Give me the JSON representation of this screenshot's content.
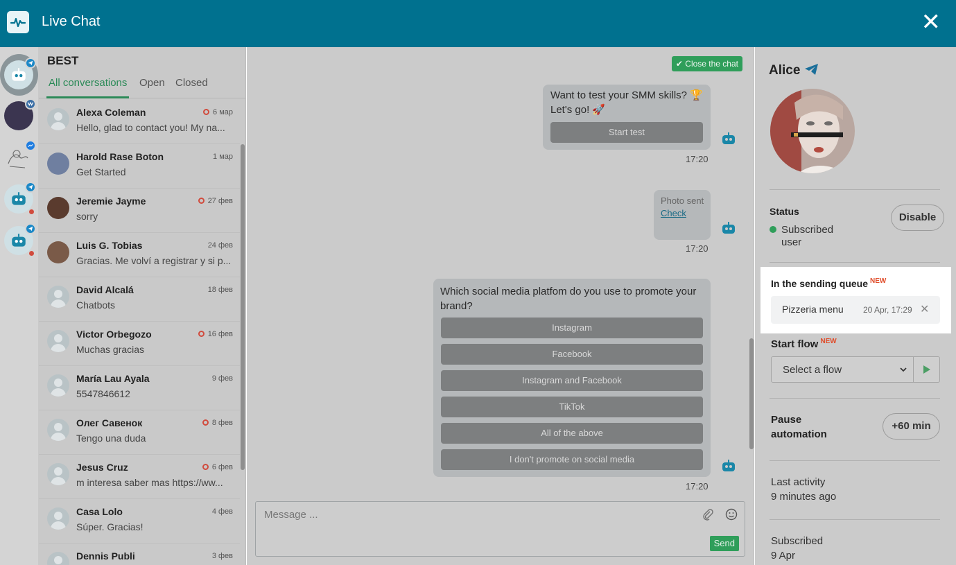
{
  "header": {
    "title": "Live Chat",
    "close_symbol": "✕",
    "bg_color": "#00718f"
  },
  "conversation_list": {
    "project_name": "BEST",
    "tabs": [
      "All conversations",
      "Open",
      "Closed"
    ],
    "active_tab": "All conversations",
    "items": [
      {
        "name": "Alexa Coleman",
        "date": "6 мар",
        "unread": true,
        "message": "Hello, glad to contact you! My na..."
      },
      {
        "name": "Harold Rase Boton",
        "date": "1 мар",
        "unread": false,
        "message": "Get Started"
      },
      {
        "name": "Jeremie Jayme",
        "date": "27 фев",
        "unread": true,
        "message": "sorry"
      },
      {
        "name": "Luis G. Tobias",
        "date": "24 фев",
        "unread": false,
        "message": "Gracias. Me volví a registrar y si p..."
      },
      {
        "name": "David Alcalá",
        "date": "18 фев",
        "unread": false,
        "message": "Chatbots"
      },
      {
        "name": "Victor Orbegozo",
        "date": "16 фев",
        "unread": true,
        "message": "Muchas gracias"
      },
      {
        "name": "María Lau Ayala",
        "date": "9 фев",
        "unread": false,
        "message": "5547846612"
      },
      {
        "name": "Олег Савенок",
        "date": "8 фев",
        "unread": true,
        "message": "Tengo una duda"
      },
      {
        "name": "Jesus Cruz",
        "date": "6 фев",
        "unread": true,
        "message": "m interesa saber mas https://ww..."
      },
      {
        "name": "Casa Lolo",
        "date": "4 фев",
        "unread": false,
        "message": "Súper. Gracias!"
      },
      {
        "name": "Dennis Publi",
        "date": "3 фев",
        "unread": false,
        "message": ""
      }
    ]
  },
  "chat": {
    "close_button": "Close the chat",
    "messages": [
      {
        "text_line1": "Want to test your SMM skills? 🏆",
        "text_line2": "Let's go! 🚀",
        "button": "Start test",
        "time": "17:20"
      },
      {
        "photo_label": "Photo sent",
        "photo_link": "Check",
        "time": "17:20"
      },
      {
        "text_line1": "Which social media platfom do you use to promote your",
        "text_line2": "brand?",
        "buttons": [
          "Instagram",
          "Facebook",
          "Instagram and Facebook",
          "TikTok",
          "All of the above",
          "I don't promote on social media"
        ],
        "time": "17:20"
      }
    ],
    "composer_placeholder": "Message ...",
    "send_label": "Send"
  },
  "profile": {
    "name": "Alice",
    "status_label": "Status",
    "status_line1": "Subscribed",
    "status_line2": "user",
    "disable_button": "Disable",
    "queue_title": "In the sending queue",
    "new_tag": "NEW",
    "queue_item_name": "Pizzeria menu",
    "queue_item_date": "20 Apr, 17:29",
    "start_flow_label": "Start flow",
    "select_flow_placeholder": "Select a flow",
    "pause_line1": "Pause",
    "pause_line2": "automation",
    "pause_button": "+60 min",
    "last_activity_label": "Last activity",
    "last_activity_value": "9 minutes ago",
    "subscribed_label": "Subscribed",
    "subscribed_value": "9 Apr"
  }
}
